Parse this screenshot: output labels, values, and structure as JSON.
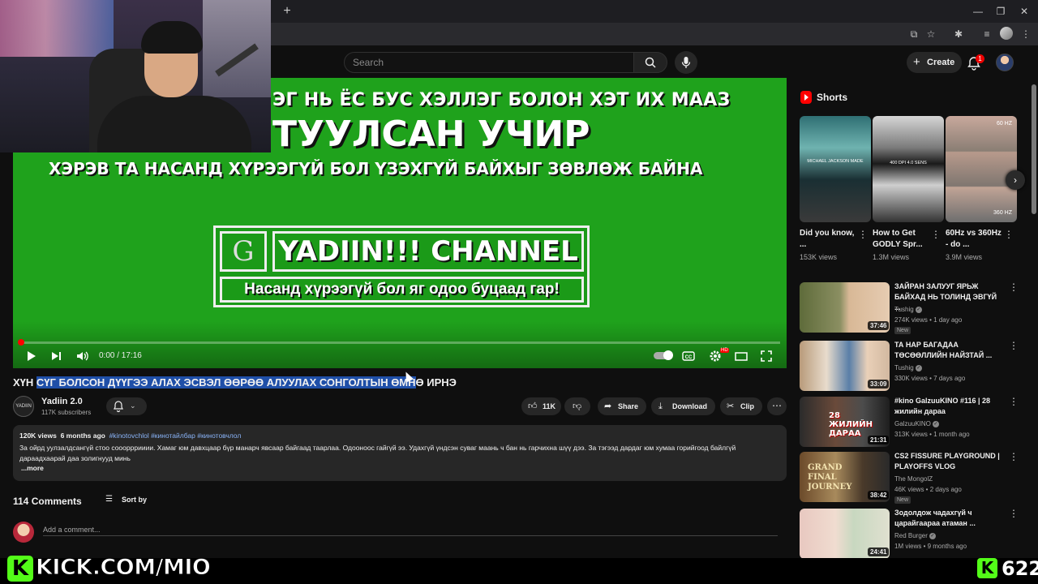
{
  "browser": {
    "new_tab_icon": "+",
    "window_controls": [
      "—",
      "❐",
      "✕"
    ]
  },
  "masthead": {
    "search_placeholder": "Search",
    "create_label": "Create",
    "notification_count": "1"
  },
  "video": {
    "overlay_line1": "ЭГ НЬ ЁС БУС ХЭЛЛЭГ БОЛОН ХЭТ ИХ МААЗ",
    "overlay_line2": "ТУУЛСАН УЧИР",
    "overlay_line3": "ХЭРЭВ ТА НАСАНД ХҮРЭЭГҮЙ БОЛ ҮЗЭХГҮЙ БАЙХЫГ ЗӨВЛӨЖ БАЙНА",
    "logo_letter": "G",
    "logo_name": "YADIIN!!! CHANNEL",
    "logo_tagline": "Насанд хүрээгүй бол яг одоо буцаад гар!",
    "time": "0:00 / 17:16",
    "progress": 0.0,
    "hd_badge": "HD"
  },
  "title": {
    "prefix": "ХҮН ",
    "selected": "СҮГ БОЛСОН ДҮҮГЭЭ АЛАХ ЭСВЭЛ ӨӨРӨӨ АЛУУЛАХ СОНГОЛТЫН ӨМН",
    "suffix": "Ө ИРНЭ"
  },
  "channel": {
    "avatar_text": "YADIIN",
    "name": "Yadiin 2.0",
    "subscribers": "117K subscribers"
  },
  "actions": {
    "likes": "11K",
    "share": "Share",
    "download": "Download",
    "clip": "Clip"
  },
  "description": {
    "views": "120K views",
    "date": "6 months ago",
    "tags": "#kinotovchlol #кинотайлбар #кинотовчлол",
    "body": "За ойрд уулзалдсангүй стоо сооорррииии. Хамаг юм давхцаар бүр манарч явсаар байгаад таарлаа. Одооноос гайгүй ээ. Удахгүй үндсэн суваг маань ч бан нь гарчихна шүү дээ. За тэгээд дардаг юм хумаа горийгоод байлгүй дараадхаарай даа золигнууд минь",
    "more": "...more"
  },
  "comments": {
    "count": "114 Comments",
    "sort_label": "Sort by",
    "add_placeholder": "Add a comment..."
  },
  "shorts": {
    "heading": "Shorts",
    "items": [
      {
        "title": "Did you know, ...",
        "views": "153K views",
        "caption": "MICHAEL JACKSON MADE"
      },
      {
        "title": "How to Get GODLY Spr...",
        "views": "1.3M views",
        "caption": "400 DPI 4.0 SENS"
      },
      {
        "title": "60Hz vs 360Hz - do ...",
        "views": "3.9M views",
        "caption_top": "60 HZ",
        "caption_bottom": "360 HZ"
      }
    ]
  },
  "recommendations": [
    {
      "title": "ЗАЙРАН ЗАЛУУГ ЯРЬЖ БАЙХАД НЬ ТОЛИНД ЭВГҮЙ ...",
      "channel": "Tushig",
      "meta": "274K views • 1 day ago",
      "duration": "37:46",
      "badge": "New"
    },
    {
      "title": "ТА НАР БАГАДАА ТӨСӨӨЛЛИЙН НАЙЗТАЙ ...",
      "channel": "Tushig",
      "meta": "330K views • 7 days ago",
      "duration": "33:09"
    },
    {
      "title": "#kino GalzuuKINO #116 | 28 жилийн дараа",
      "channel": "GalzuuKINO",
      "meta": "313K views • 1 month ago",
      "duration": "21:31",
      "thumb_text": "28 ЖИЛИЙН ДАРАА"
    },
    {
      "title": "CS2 FISSURE PLAYGROUND | PLAYOFFS VLOG",
      "channel": "The MongolZ",
      "meta": "46K views • 2 days ago",
      "duration": "38:42",
      "badge": "New",
      "thumb_text": "GRAND FINAL JOURNEY"
    },
    {
      "title": "Зодолдож чадахгүй ч царайгаараа атаман ...",
      "channel": "Red Burger",
      "meta": "1M views • 9 months ago",
      "duration": "24:41"
    }
  ],
  "overlay": {
    "kick_logo": "K",
    "kick_url": "KICK.COM/MIO",
    "viewer_count": "622"
  },
  "colors": {
    "background": "#0f0f0f",
    "video_green": "#1fa21c",
    "kick_green": "#53fc18",
    "selection": "#1f4fa8",
    "link": "#8ab4f8"
  }
}
